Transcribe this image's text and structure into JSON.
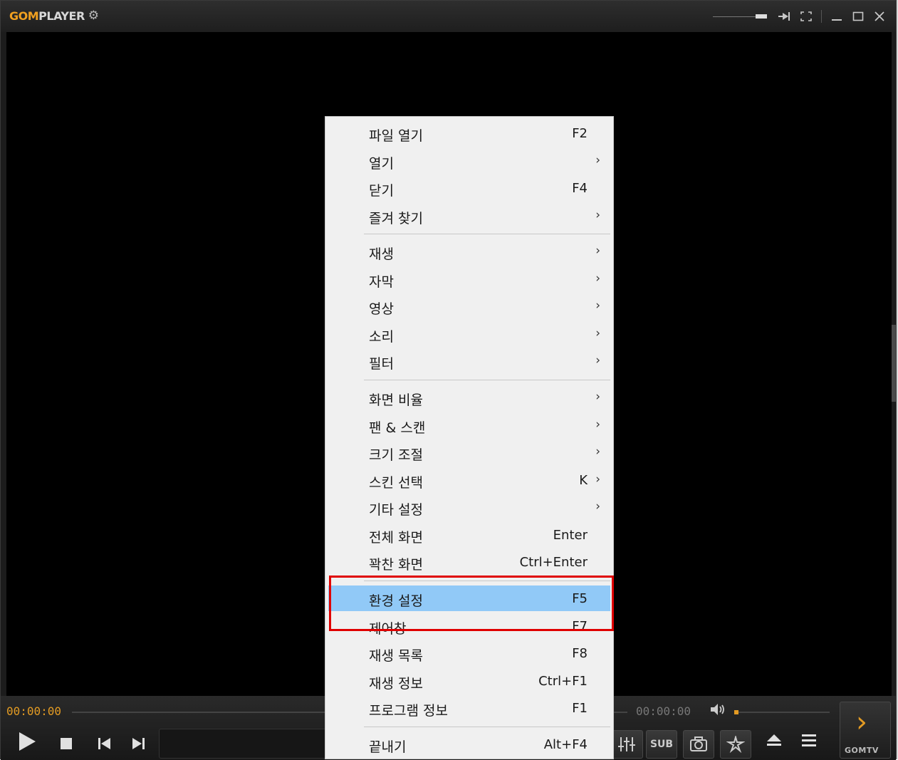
{
  "app": {
    "logo_gom": "GOM",
    "logo_player": "PLAYER"
  },
  "titlebar": {
    "icons": [
      "gear-icon",
      "volume-slider",
      "pin-icon",
      "fullscreen-icon",
      "minimize-icon",
      "maximize-icon",
      "close-icon"
    ]
  },
  "controls": {
    "time_current": "00:00:00",
    "time_total": "00:00:00",
    "sub_label": "SUB",
    "gomtv_label": "GOMTV",
    "accent_color": "#e39b23"
  },
  "menu": {
    "items": [
      {
        "label": "파일 열기",
        "shortcut": "F2",
        "arrow": ""
      },
      {
        "label": "열기",
        "shortcut": "",
        "arrow": "›"
      },
      {
        "label": "닫기",
        "shortcut": "F4",
        "arrow": ""
      },
      {
        "label": "즐겨 찾기",
        "shortcut": "",
        "arrow": "›"
      },
      {
        "label": "재생",
        "shortcut": "",
        "arrow": "›"
      },
      {
        "label": "자막",
        "shortcut": "",
        "arrow": "›"
      },
      {
        "label": "영상",
        "shortcut": "",
        "arrow": "›"
      },
      {
        "label": "소리",
        "shortcut": "",
        "arrow": "›"
      },
      {
        "label": "필터",
        "shortcut": "",
        "arrow": "›"
      },
      {
        "label": "화면 비율",
        "shortcut": "",
        "arrow": "›"
      },
      {
        "label": "팬 & 스캔",
        "shortcut": "",
        "arrow": "›"
      },
      {
        "label": "크기 조절",
        "shortcut": "",
        "arrow": "›"
      },
      {
        "label": "스킨 선택",
        "shortcut": "K",
        "arrow": "›"
      },
      {
        "label": "기타 설정",
        "shortcut": "",
        "arrow": "›"
      },
      {
        "label": "전체 화면",
        "shortcut": "Enter",
        "arrow": ""
      },
      {
        "label": "꽉찬 화면",
        "shortcut": "Ctrl+Enter",
        "arrow": ""
      },
      {
        "label": "환경 설정",
        "shortcut": "F5",
        "arrow": ""
      },
      {
        "label": "제어창",
        "shortcut": "F7",
        "arrow": ""
      },
      {
        "label": "재생 목록",
        "shortcut": "F8",
        "arrow": ""
      },
      {
        "label": "재생 정보",
        "shortcut": "Ctrl+F1",
        "arrow": ""
      },
      {
        "label": "프로그램 정보",
        "shortcut": "F1",
        "arrow": ""
      },
      {
        "label": "끝내기",
        "shortcut": "Alt+F4",
        "arrow": ""
      }
    ],
    "highlight_color": "#91c9f7",
    "annotation_color": "#e00000"
  }
}
